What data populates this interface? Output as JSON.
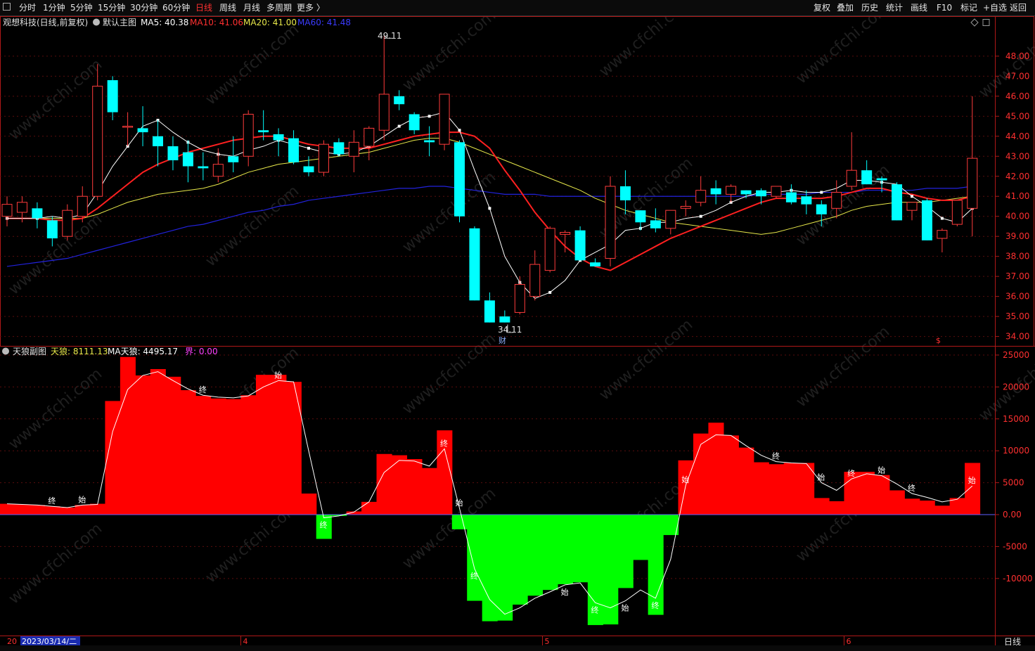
{
  "toolbar": {
    "left": [
      {
        "name": "tab-timeshare",
        "label": "分时"
      },
      {
        "name": "tab-1min",
        "label": "1分钟"
      },
      {
        "name": "tab-5min",
        "label": "5分钟"
      },
      {
        "name": "tab-15min",
        "label": "15分钟"
      },
      {
        "name": "tab-30min",
        "label": "30分钟"
      },
      {
        "name": "tab-60min",
        "label": "60分钟"
      },
      {
        "name": "tab-daily",
        "label": "日线",
        "active": true
      },
      {
        "name": "tab-weekly",
        "label": "周线"
      },
      {
        "name": "tab-monthly",
        "label": "月线"
      },
      {
        "name": "tab-multi-period",
        "label": "多周期"
      },
      {
        "name": "tab-more",
        "label": "更多 〉"
      }
    ],
    "right": [
      {
        "name": "restore-rights-button",
        "label": "复权"
      },
      {
        "name": "overlay-button",
        "label": "叠加"
      },
      {
        "name": "history-button",
        "label": "历史"
      },
      {
        "name": "statistics-button",
        "label": "统计"
      },
      {
        "name": "draw-line-button",
        "label": "画线"
      },
      {
        "name": "f10-button",
        "label": "F10"
      },
      {
        "name": "mark-button",
        "label": "标记"
      },
      {
        "name": "add-watchlist-button",
        "label": "+自选"
      },
      {
        "name": "back-button",
        "label": "返回"
      }
    ]
  },
  "main_legend": {
    "stock": "观想科技(日线,前复权)",
    "indicator": "默认主图",
    "ma5": "MA5: 40.38",
    "ma10": "MA10: 41.06",
    "ma20": "MA20: 41.00",
    "ma60": "MA60: 41.48"
  },
  "sub_legend": {
    "name": "天狼副图",
    "tianlang": "天狼: 8111.13",
    "ma_tianlang": "MA天狼: 4495.17",
    "jie": "界: 0.00"
  },
  "annotations": {
    "high": "49.11",
    "low": "34.11",
    "caifu": "财",
    "dollar": "$"
  },
  "bottom": {
    "date": "2023/03/14/二",
    "period": "日线",
    "month_ticks": [
      "4",
      "5",
      "6"
    ],
    "left_stub": "20"
  },
  "watermark": "www.cfchi.com",
  "colors": {
    "up": "#ff3b3b",
    "down": "#00ffff",
    "ma5": "#ffffff",
    "ma10": "#ff2020",
    "ma20": "#e8e84a",
    "ma60": "#2222dd",
    "pos": "#ff0000",
    "neg": "#00ff00",
    "axis": "#b01818"
  },
  "chart_data": [
    {
      "type": "candlestick",
      "title": "观想科技(日线,前复权)",
      "ylim": [
        33.6,
        49.4
      ],
      "y_ticks": [
        34,
        35,
        36,
        37,
        38,
        39,
        40,
        41,
        42,
        43,
        44,
        45,
        46,
        47,
        48
      ],
      "month_ticks": [
        {
          "label": "4",
          "index": 16
        },
        {
          "label": "5",
          "index": 36
        },
        {
          "label": "6",
          "index": 56
        }
      ],
      "candles": [
        {
          "o": 40.0,
          "h": 41.0,
          "l": 39.5,
          "c": 40.6
        },
        {
          "o": 40.2,
          "h": 41.0,
          "l": 39.7,
          "c": 40.7
        },
        {
          "o": 40.4,
          "h": 40.7,
          "l": 39.4,
          "c": 39.9
        },
        {
          "o": 39.8,
          "h": 40.0,
          "l": 38.5,
          "c": 38.9
        },
        {
          "o": 39.0,
          "h": 40.6,
          "l": 38.8,
          "c": 40.3
        },
        {
          "o": 40.0,
          "h": 41.5,
          "l": 39.7,
          "c": 41.0
        },
        {
          "o": 41.0,
          "h": 47.6,
          "l": 40.8,
          "c": 46.5
        },
        {
          "o": 46.8,
          "h": 47.0,
          "l": 44.8,
          "c": 45.2
        },
        {
          "o": 44.5,
          "h": 45.2,
          "l": 43.5,
          "c": 44.5
        },
        {
          "o": 44.4,
          "h": 45.5,
          "l": 43.5,
          "c": 44.2
        },
        {
          "o": 44.0,
          "h": 44.8,
          "l": 42.5,
          "c": 43.5
        },
        {
          "o": 43.5,
          "h": 44.0,
          "l": 42.3,
          "c": 42.8
        },
        {
          "o": 43.2,
          "h": 43.8,
          "l": 41.7,
          "c": 42.5
        },
        {
          "o": 42.5,
          "h": 43.2,
          "l": 41.8,
          "c": 42.4
        },
        {
          "o": 42.0,
          "h": 43.4,
          "l": 41.7,
          "c": 42.6
        },
        {
          "o": 43.0,
          "h": 44.0,
          "l": 42.2,
          "c": 42.7
        },
        {
          "o": 43.0,
          "h": 45.3,
          "l": 42.5,
          "c": 45.1
        },
        {
          "o": 44.3,
          "h": 45.3,
          "l": 43.8,
          "c": 44.2
        },
        {
          "o": 44.1,
          "h": 44.4,
          "l": 43.0,
          "c": 43.8
        },
        {
          "o": 43.9,
          "h": 44.3,
          "l": 42.6,
          "c": 42.7
        },
        {
          "o": 42.5,
          "h": 43.0,
          "l": 42.0,
          "c": 42.2
        },
        {
          "o": 42.2,
          "h": 43.8,
          "l": 42.0,
          "c": 43.6
        },
        {
          "o": 43.7,
          "h": 43.9,
          "l": 43.0,
          "c": 43.1
        },
        {
          "o": 43.0,
          "h": 44.3,
          "l": 42.2,
          "c": 43.7
        },
        {
          "o": 43.5,
          "h": 44.5,
          "l": 42.8,
          "c": 44.4
        },
        {
          "o": 44.3,
          "h": 49.0,
          "l": 43.8,
          "c": 46.1
        },
        {
          "o": 46.0,
          "h": 46.3,
          "l": 45.3,
          "c": 45.6
        },
        {
          "o": 45.1,
          "h": 45.2,
          "l": 44.1,
          "c": 44.3
        },
        {
          "o": 43.8,
          "h": 44.5,
          "l": 43.0,
          "c": 43.7
        },
        {
          "o": 43.6,
          "h": 44.3,
          "l": 43.3,
          "c": 46.1
        },
        {
          "o": 43.7,
          "h": 43.8,
          "l": 39.7,
          "c": 40.0
        },
        {
          "o": 39.4,
          "h": 39.5,
          "l": 35.8,
          "c": 35.8
        },
        {
          "o": 35.8,
          "h": 36.2,
          "l": 34.7,
          "c": 34.7
        },
        {
          "o": 35.0,
          "h": 35.3,
          "l": 34.7,
          "c": 34.7
        },
        {
          "o": 35.2,
          "h": 37.0,
          "l": 35.1,
          "c": 36.6
        },
        {
          "o": 36.0,
          "h": 38.3,
          "l": 35.8,
          "c": 37.6
        },
        {
          "o": 37.3,
          "h": 39.5,
          "l": 37.2,
          "c": 39.4
        },
        {
          "o": 39.1,
          "h": 39.3,
          "l": 38.2,
          "c": 39.2
        },
        {
          "o": 39.3,
          "h": 39.5,
          "l": 37.8,
          "c": 37.8
        },
        {
          "o": 37.7,
          "h": 37.9,
          "l": 37.6,
          "c": 37.5
        },
        {
          "o": 37.9,
          "h": 42.0,
          "l": 37.5,
          "c": 41.5
        },
        {
          "o": 41.5,
          "h": 42.3,
          "l": 40.1,
          "c": 40.8
        },
        {
          "o": 40.3,
          "h": 40.3,
          "l": 39.3,
          "c": 39.7
        },
        {
          "o": 39.8,
          "h": 40.4,
          "l": 39.2,
          "c": 39.4
        },
        {
          "o": 39.4,
          "h": 40.3,
          "l": 39.1,
          "c": 40.3
        },
        {
          "o": 40.4,
          "h": 40.8,
          "l": 40.0,
          "c": 40.5
        },
        {
          "o": 40.7,
          "h": 42.0,
          "l": 40.5,
          "c": 41.3
        },
        {
          "o": 41.4,
          "h": 41.8,
          "l": 40.6,
          "c": 41.1
        },
        {
          "o": 41.1,
          "h": 41.6,
          "l": 40.7,
          "c": 41.5
        },
        {
          "o": 41.3,
          "h": 41.3,
          "l": 40.9,
          "c": 41.1
        },
        {
          "o": 41.3,
          "h": 41.4,
          "l": 40.6,
          "c": 41.0
        },
        {
          "o": 41.0,
          "h": 41.4,
          "l": 40.9,
          "c": 41.5
        },
        {
          "o": 41.2,
          "h": 41.6,
          "l": 40.6,
          "c": 40.7
        },
        {
          "o": 41.0,
          "h": 41.3,
          "l": 40.1,
          "c": 40.6
        },
        {
          "o": 40.6,
          "h": 40.8,
          "l": 39.5,
          "c": 40.1
        },
        {
          "o": 40.4,
          "h": 41.8,
          "l": 39.9,
          "c": 41.2
        },
        {
          "o": 41.5,
          "h": 44.2,
          "l": 41.3,
          "c": 42.3
        },
        {
          "o": 42.3,
          "h": 42.8,
          "l": 41.6,
          "c": 41.6
        },
        {
          "o": 41.9,
          "h": 42.0,
          "l": 41.2,
          "c": 41.8
        },
        {
          "o": 41.6,
          "h": 41.7,
          "l": 39.8,
          "c": 39.8
        },
        {
          "o": 40.3,
          "h": 40.5,
          "l": 39.8,
          "c": 40.7
        },
        {
          "o": 40.8,
          "h": 40.9,
          "l": 38.8,
          "c": 38.8
        },
        {
          "o": 38.9,
          "h": 39.4,
          "l": 38.2,
          "c": 39.3
        },
        {
          "o": 39.6,
          "h": 40.8,
          "l": 39.5,
          "c": 40.8
        },
        {
          "o": 40.4,
          "h": 46.0,
          "l": 39.0,
          "c": 42.9
        }
      ],
      "ma5": [
        39.9,
        39.9,
        39.9,
        40.0,
        39.9,
        40.1,
        41.2,
        42.5,
        43.5,
        44.5,
        44.8,
        44.2,
        43.7,
        43.3,
        43.1,
        43.0,
        43.3,
        43.5,
        43.8,
        43.6,
        43.4,
        43.2,
        43.1,
        43.2,
        43.5,
        44.0,
        44.5,
        44.9,
        45.0,
        45.2,
        44.3,
        42.3,
        40.4,
        38.0,
        36.7,
        35.9,
        36.2,
        36.8,
        37.8,
        38.2,
        38.6,
        39.3,
        39.4,
        39.7,
        39.7,
        39.9,
        40.0,
        40.3,
        40.7,
        41.0,
        41.2,
        41.2,
        41.3,
        41.2,
        41.2,
        41.4,
        41.8,
        41.8,
        41.7,
        41.6,
        41.0,
        40.5,
        39.9,
        39.7,
        40.4
      ],
      "ma10": [
        39.9,
        39.9,
        39.9,
        39.8,
        39.8,
        39.9,
        40.4,
        41.0,
        41.6,
        42.2,
        42.6,
        42.9,
        43.2,
        43.4,
        43.6,
        43.8,
        43.9,
        44.0,
        44.0,
        43.8,
        43.6,
        43.5,
        43.4,
        43.4,
        43.4,
        43.6,
        43.8,
        44.0,
        44.1,
        44.2,
        44.2,
        44.0,
        43.4,
        42.3,
        41.3,
        40.2,
        39.3,
        38.5,
        37.9,
        37.5,
        37.3,
        37.7,
        38.1,
        38.5,
        38.9,
        39.2,
        39.5,
        39.8,
        40.1,
        40.4,
        40.7,
        40.9,
        40.9,
        40.9,
        40.9,
        41.0,
        41.2,
        41.4,
        41.4,
        41.2,
        41.1,
        40.9,
        40.8,
        40.8,
        41.0
      ],
      "ma20": [
        39.9,
        39.9,
        39.9,
        39.9,
        39.9,
        39.9,
        40.1,
        40.4,
        40.7,
        40.9,
        41.1,
        41.2,
        41.3,
        41.4,
        41.6,
        41.9,
        42.2,
        42.4,
        42.6,
        42.7,
        42.8,
        42.9,
        43.0,
        43.1,
        43.2,
        43.4,
        43.6,
        43.8,
        43.9,
        43.9,
        43.7,
        43.4,
        43.1,
        42.8,
        42.5,
        42.2,
        41.9,
        41.6,
        41.3,
        40.9,
        40.6,
        40.3,
        40.1,
        39.9,
        39.7,
        39.6,
        39.5,
        39.4,
        39.3,
        39.2,
        39.1,
        39.2,
        39.4,
        39.6,
        39.8,
        40.0,
        40.3,
        40.5,
        40.6,
        40.7,
        40.7,
        40.7,
        40.8,
        40.9,
        41.0
      ],
      "ma60": [
        37.5,
        37.6,
        37.7,
        37.8,
        37.9,
        38.1,
        38.3,
        38.5,
        38.7,
        38.9,
        39.1,
        39.3,
        39.5,
        39.6,
        39.8,
        40.0,
        40.2,
        40.3,
        40.5,
        40.6,
        40.8,
        40.9,
        41.0,
        41.1,
        41.2,
        41.3,
        41.4,
        41.4,
        41.5,
        41.5,
        41.4,
        41.3,
        41.2,
        41.1,
        41.1,
        41.1,
        41.0,
        41.0,
        41.0,
        41.0,
        41.0,
        41.0,
        41.0,
        41.0,
        41.0,
        41.0,
        41.0,
        41.0,
        41.0,
        41.0,
        41.1,
        41.1,
        41.1,
        41.1,
        41.2,
        41.2,
        41.2,
        41.3,
        41.3,
        41.3,
        41.3,
        41.4,
        41.4,
        41.4,
        41.5
      ]
    },
    {
      "type": "bar",
      "title": "天狼副图",
      "ylim": [
        -18500,
        25000
      ],
      "y_ticks": [
        25000,
        20000,
        15000,
        10000,
        5000,
        0,
        -5000,
        -10000
      ],
      "values": [
        1700,
        1600,
        1500,
        1300,
        1100,
        1500,
        1700,
        17800,
        24700,
        21800,
        22800,
        21600,
        19500,
        18600,
        18200,
        18100,
        18700,
        21900,
        21900,
        20800,
        3300,
        -3800,
        -200,
        500,
        2000,
        9500,
        9300,
        8700,
        7300,
        13200,
        -2300,
        -13500,
        -16700,
        -16600,
        -14100,
        -12700,
        -11800,
        -10900,
        -10600,
        -17300,
        -17200,
        -11500,
        -7100,
        -15700,
        -3200,
        8500,
        12700,
        14400,
        12400,
        10500,
        8200,
        7900,
        8100,
        8100,
        2600,
        2100,
        6700,
        6700,
        6200,
        3800,
        2500,
        2200,
        1400,
        2600,
        8100
      ],
      "ma": [
        1700,
        1600,
        1500,
        1300,
        1100,
        1500,
        1600,
        13000,
        19600,
        21800,
        22400,
        21000,
        19700,
        18700,
        18400,
        18300,
        18600,
        20000,
        21000,
        20800,
        10000,
        -500,
        -200,
        400,
        2000,
        6600,
        8500,
        8400,
        7600,
        10300,
        1000,
        -8500,
        -13300,
        -15600,
        -14600,
        -13100,
        -12100,
        -11000,
        -10700,
        -13800,
        -14600,
        -13500,
        -11800,
        -13100,
        -7000,
        4600,
        11000,
        12500,
        12400,
        10800,
        9300,
        8300,
        8100,
        8000,
        5000,
        3800,
        5600,
        6400,
        6100,
        4800,
        3300,
        2700,
        2000,
        2400,
        4495
      ],
      "labels": [
        {
          "i": 3,
          "t": "终"
        },
        {
          "i": 5,
          "t": "始"
        },
        {
          "i": 13,
          "t": "终"
        },
        {
          "i": 18,
          "t": "始"
        },
        {
          "i": 21,
          "t": "终"
        },
        {
          "i": 29,
          "t": "终"
        },
        {
          "i": 30,
          "t": "始"
        },
        {
          "i": 31,
          "t": "终"
        },
        {
          "i": 37,
          "t": "始"
        },
        {
          "i": 39,
          "t": "终"
        },
        {
          "i": 41,
          "t": "始"
        },
        {
          "i": 43,
          "t": "终"
        },
        {
          "i": 45,
          "t": "始"
        },
        {
          "i": 51,
          "t": "终"
        },
        {
          "i": 54,
          "t": "始"
        },
        {
          "i": 56,
          "t": "终"
        },
        {
          "i": 58,
          "t": "始"
        },
        {
          "i": 60,
          "t": "终"
        },
        {
          "i": 64,
          "t": "始"
        }
      ]
    }
  ]
}
